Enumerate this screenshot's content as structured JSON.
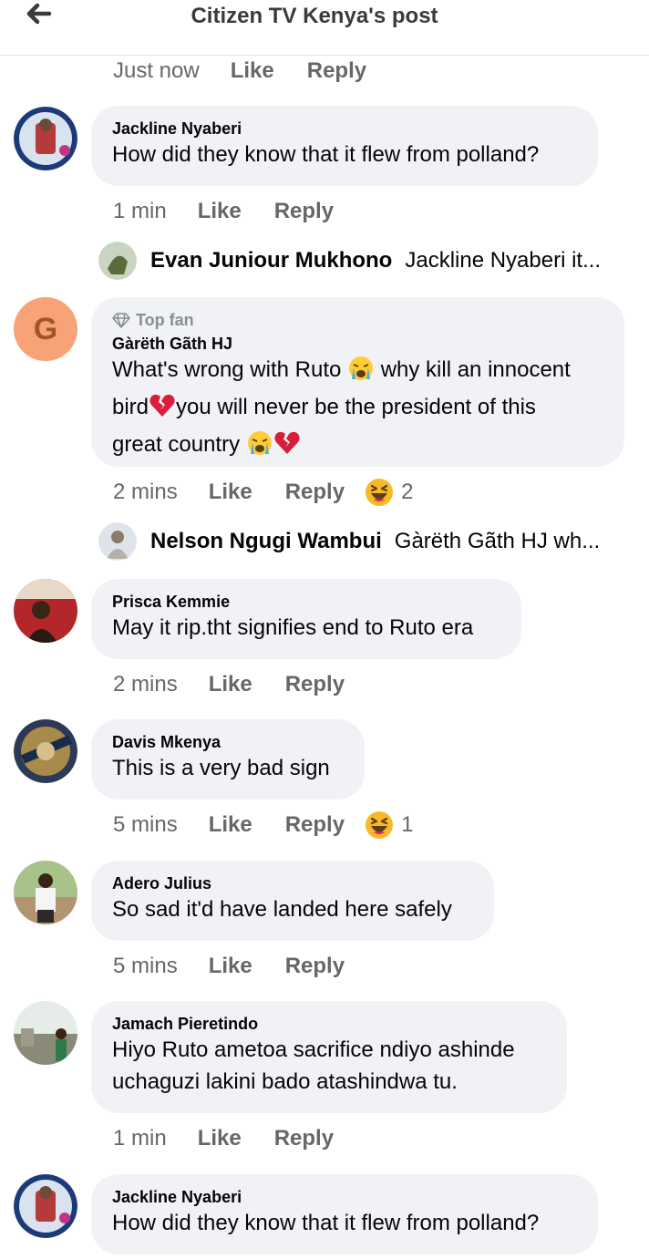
{
  "header": {
    "title": "Citizen TV Kenya's post"
  },
  "labels": {
    "like": "Like",
    "reply": "Reply"
  },
  "top_actions": {
    "time": "Just now"
  },
  "comments": [
    {
      "author": "Jackline Nyaberi",
      "text": "How did they know that it flew from polland?",
      "time": "1 min"
    },
    {
      "author": "Gàrëth Gãth HJ",
      "badge": "Top fan",
      "line1": "What's wrong with Ruto",
      "line2": "why kill an innocent",
      "line3": "bird",
      "line4": "you will never be the president of this",
      "line5": "great country",
      "time": "2 mins",
      "reaction_count": "2"
    },
    {
      "author": "Prisca Kemmie",
      "text": "May it rip.tht signifies end to Ruto era",
      "time": "2 mins"
    },
    {
      "author": "Davis Mkenya",
      "text": "This is a very bad sign",
      "time": "5 mins",
      "reaction_count": "1"
    },
    {
      "author": "Adero Julius",
      "text": "So sad it'd have landed here safely",
      "time": "5 mins"
    },
    {
      "author": "Jamach Pieretindo",
      "line1": "Hiyo Ruto ametoa sacrifice ndiyo ashinde",
      "line2": "uchaguzi lakini bado atashindwa tu.",
      "time": "1 min"
    },
    {
      "author": "Jackline Nyaberi",
      "text": "How did they know that it flew from polland?"
    }
  ],
  "replies": [
    {
      "name": "Evan Juniour Mukhono",
      "preview": "Jackline Nyaberi it..."
    },
    {
      "name": "Nelson Ngugi Wambui",
      "preview": "Gàrëth Gãth HJ wh..."
    }
  ],
  "avatar_letter": "G",
  "colors": {
    "bubble": "#f0f2f5",
    "muted": "#65676b",
    "text": "#050505",
    "avatar_g": "#f7a377"
  }
}
